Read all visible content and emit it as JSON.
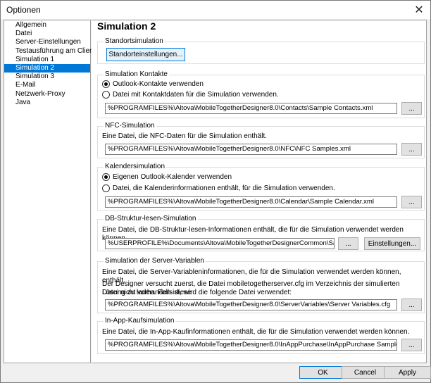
{
  "window": {
    "title": "Optionen",
    "close_glyph": "✕"
  },
  "sidebar": {
    "items": [
      {
        "label": "Allgemein"
      },
      {
        "label": "Datei"
      },
      {
        "label": "Server-Einstellungen"
      },
      {
        "label": "Testausführung am Client"
      },
      {
        "label": "Simulation 1"
      },
      {
        "label": "Simulation 2",
        "selected": true
      },
      {
        "label": "Simulation 3"
      },
      {
        "label": "E-Mail"
      },
      {
        "label": "Netzwerk-Proxy"
      },
      {
        "label": "Java"
      }
    ]
  },
  "page": {
    "title": "Simulation 2"
  },
  "standort": {
    "label": "Standortsimulation",
    "button": "Standorteinstellungen..."
  },
  "kontakte": {
    "label": "Simulation Kontakte",
    "option1": "Outlook-Kontakte verwenden",
    "option2": "Datei mit Kontaktdaten für die Simulation verwenden.",
    "path": "%PROGRAMFILES%\\Altova\\MobileTogetherDesigner8.0\\Contacts\\Sample Contacts.xml",
    "browse": "..."
  },
  "nfc": {
    "label": "NFC-Simulation",
    "desc": "Eine Datei, die NFC-Daten für die Simulation enthält.",
    "path": "%PROGRAMFILES%\\Altova\\MobileTogetherDesigner8.0\\NFC\\NFC Samples.xml",
    "browse": "..."
  },
  "kalender": {
    "label": "Kalendersimulation",
    "option1": "Eigenen Outlook-Kalender verwenden",
    "option2": "Datei, die Kalenderinformationen enthält, für die Simulation verwenden.",
    "path": "%PROGRAMFILES%\\Altova\\MobileTogetherDesigner8.0\\Calendar\\Sample Calendar.xml",
    "browse": "..."
  },
  "dbstruktur": {
    "label": "DB-Struktur-lesen-Simulation",
    "desc": "Eine Datei, die DB-Struktur-lesen-Informationen enthält, die für die Simulation verwendet werden können.",
    "path": "%USERPROFILE%\\Documents\\Altova\\MobileTogetherDesignerCommon\\Sample DB Reac",
    "browse": "...",
    "settings": "Einstellungen..."
  },
  "servervariablen": {
    "label": "Simulation der Server-Variablen",
    "desc1": "Eine Datei, die Server-Variableninformationen, die für die Simulation verwendet werden können, enthält.",
    "desc2": "Der Designer versucht zuerst, die Datei mobiletogetherserver.cfg im Verzeichnis der simulierten Lösung zu laden. Falls diese",
    "desc3": "Datei nicht vorhanden ist, wird die folgende Datei verwendet:",
    "path": "%PROGRAMFILES%\\Altova\\MobileTogetherDesigner8.0\\ServerVariables\\Server Variables.cfg",
    "browse": "..."
  },
  "inapp": {
    "label": "In-App-Kaufsimulation",
    "desc": "Eine Datei, die In-App-Kaufinformationen enthält, die für die Simulation verwendet werden können.",
    "path": "%PROGRAMFILES%\\Altova\\MobileTogetherDesigner8.0\\InAppPurchase\\InAppPurchase Samples.xml",
    "browse": "..."
  },
  "footer": {
    "ok": "OK",
    "cancel": "Cancel",
    "apply": "Apply"
  }
}
